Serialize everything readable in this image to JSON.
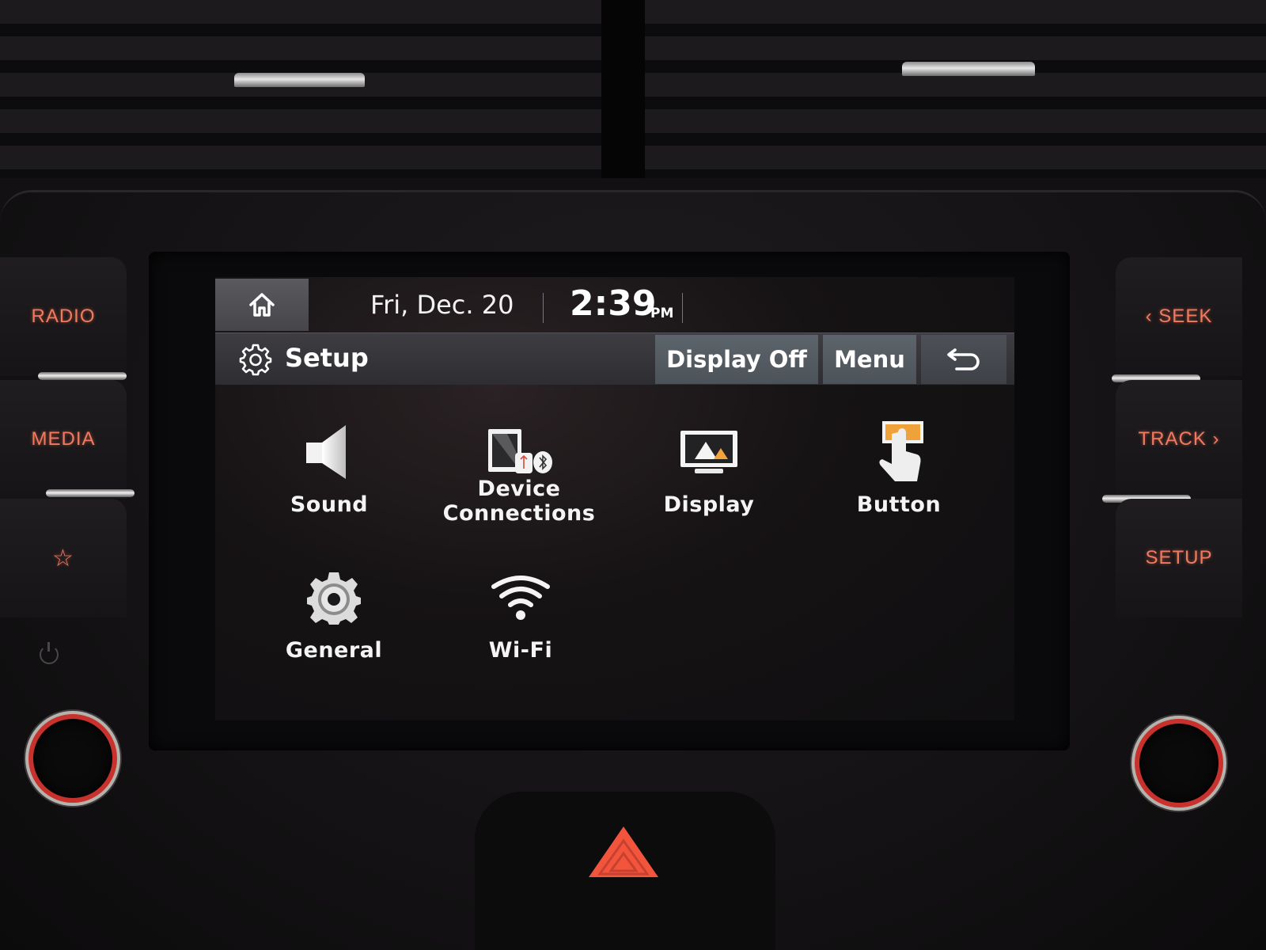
{
  "dashboard": {
    "left_buttons": [
      {
        "label": "RADIO",
        "icon": null
      },
      {
        "label": "MEDIA",
        "icon": null
      },
      {
        "label": "",
        "icon": "star-icon",
        "glyph": "☆"
      }
    ],
    "right_buttons": [
      {
        "label": "‹ SEEK"
      },
      {
        "label": "TRACK ›"
      },
      {
        "label": "SETUP"
      }
    ],
    "accent_color": "#f07a5f",
    "knob_ring_color": "#c9322c",
    "hazard_color": "#f2553c"
  },
  "screen": {
    "status_bar": {
      "home_icon": "home-icon",
      "date": "Fri, Dec. 20",
      "time": "2:39",
      "ampm": "PM"
    },
    "title_bar": {
      "icon": "gear-icon",
      "title": "Setup",
      "buttons": {
        "display_off": "Display Off",
        "menu": "Menu",
        "back_icon": "back-arrow-icon"
      }
    },
    "menu_items": [
      {
        "label": "Sound",
        "icon": "speaker-icon"
      },
      {
        "label": "Device\nConnections",
        "icon": "device-connections-icon"
      },
      {
        "label": "Display",
        "icon": "monitor-icon"
      },
      {
        "label": "Button",
        "icon": "button-press-icon"
      },
      {
        "label": "General",
        "icon": "general-gear-icon"
      },
      {
        "label": "Wi-Fi",
        "icon": "wifi-icon"
      }
    ]
  }
}
